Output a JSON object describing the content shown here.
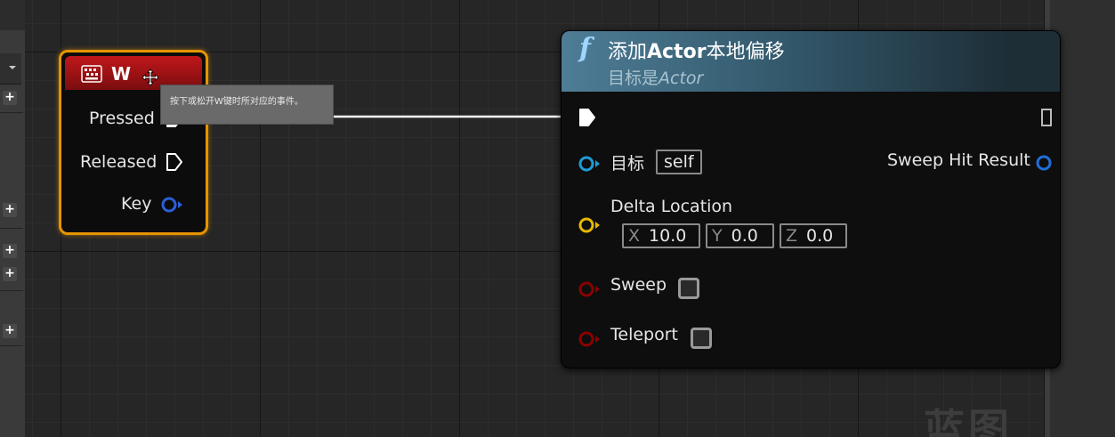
{
  "event_node": {
    "title": "W",
    "pins": {
      "pressed": "Pressed",
      "released": "Released",
      "key": "Key"
    },
    "tooltip": "按下或松开W键时所对应的事件。",
    "icons": [
      "keyboard-key-icon",
      "move-cursor-icon"
    ]
  },
  "function_node": {
    "icon": "f",
    "title_prefix": "添加",
    "title_bold": "Actor",
    "title_suffix": "本地偏移",
    "subtitle_prefix": "目标是",
    "subtitle_italic": "Actor",
    "pins": {
      "target_label": "目标",
      "target_value": "self",
      "delta_location_label": "Delta Location",
      "sweep_label": "Sweep",
      "teleport_label": "Teleport",
      "sweep_hit_result_label": "Sweep Hit Result"
    },
    "delta_location": {
      "x_axis": "X",
      "x_value": "10.0",
      "y_axis": "Y",
      "y_value": "0.0",
      "z_axis": "Z",
      "z_value": "0.0"
    },
    "sweep_checked": false,
    "teleport_checked": false
  },
  "watermark": "蓝图",
  "colors": {
    "event_header": "#c0171a",
    "event_outline": "#e59400",
    "function_header": "#4e7d96",
    "object_pin": "#1f9bd8",
    "struct_pin": "#e6b800",
    "bool_pin": "#8b0000",
    "key_pin": "#2a5fd8"
  }
}
